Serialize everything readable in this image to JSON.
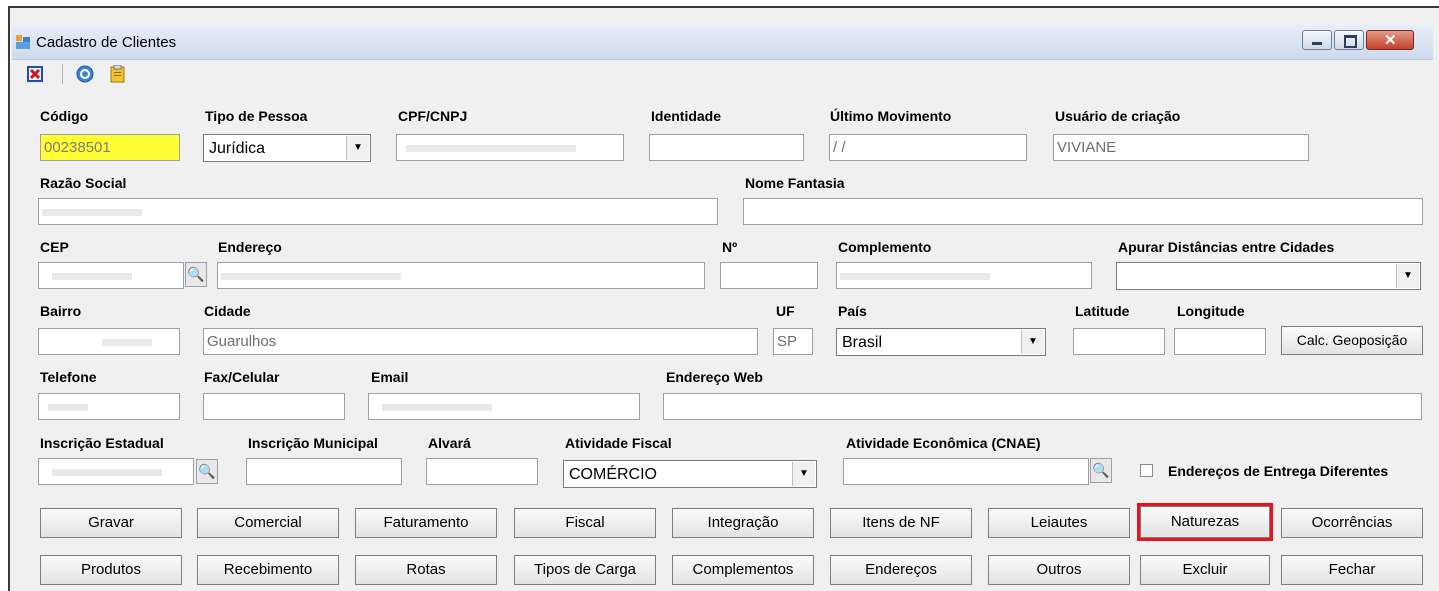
{
  "window": {
    "title": "Cadastro de Clientes"
  },
  "toolbar": {
    "icons": [
      "exit-icon",
      "help-icon",
      "clipboard-icon"
    ]
  },
  "fields": {
    "codigo": {
      "label": "Código",
      "value": "00238501"
    },
    "tipo_pessoa": {
      "label": "Tipo de Pessoa",
      "value": "Jurídica"
    },
    "cpf_cnpj": {
      "label": "CPF/CNPJ",
      "value": ""
    },
    "identidade": {
      "label": "Identidade",
      "value": ""
    },
    "ultimo_movimento": {
      "label": "Último Movimento",
      "value": "/ /"
    },
    "usuario_criacao": {
      "label": "Usuário de criação",
      "value": "VIVIANE"
    },
    "razao_social": {
      "label": "Razão Social",
      "value": ""
    },
    "nome_fantasia": {
      "label": "Nome Fantasia",
      "value": ""
    },
    "cep": {
      "label": "CEP",
      "value": ""
    },
    "endereco": {
      "label": "Endereço",
      "value": ""
    },
    "numero": {
      "label": "Nº",
      "value": ""
    },
    "complemento": {
      "label": "Complemento",
      "value": ""
    },
    "apurar_distancias": {
      "label": "Apurar Distâncias entre Cidades",
      "value": ""
    },
    "bairro": {
      "label": "Bairro",
      "value": ""
    },
    "cidade": {
      "label": "Cidade",
      "value": "Guarulhos"
    },
    "uf": {
      "label": "UF",
      "value": "SP"
    },
    "pais": {
      "label": "País",
      "value": "Brasil"
    },
    "latitude": {
      "label": "Latitude",
      "value": ""
    },
    "longitude": {
      "label": "Longitude",
      "value": ""
    },
    "telefone": {
      "label": "Telefone",
      "value": ""
    },
    "fax_celular": {
      "label": "Fax/Celular",
      "value": ""
    },
    "email": {
      "label": "Email",
      "value": ""
    },
    "endereco_web": {
      "label": "Endereço Web",
      "value": ""
    },
    "inscricao_estadual": {
      "label": "Inscrição Estadual",
      "value": ""
    },
    "inscricao_municipal": {
      "label": "Inscrição Municipal",
      "value": ""
    },
    "alvara": {
      "label": "Alvará",
      "value": ""
    },
    "atividade_fiscal": {
      "label": "Atividade Fiscal",
      "value": "COMÉRCIO"
    },
    "atividade_economica": {
      "label": "Atividade Econômica (CNAE)",
      "value": ""
    },
    "enderecos_entrega": {
      "label": "Endereços de Entrega Diferentes",
      "checked": false
    }
  },
  "buttons": {
    "calc_geoposicao": "Calc. Geoposição",
    "row1": [
      "Gravar",
      "Comercial",
      "Faturamento",
      "Fiscal",
      "Integração",
      "Itens de NF",
      "Leiautes",
      "Naturezas",
      "Ocorrências"
    ],
    "row2": [
      "Produtos",
      "Recebimento",
      "Rotas",
      "Tipos de Carga",
      "Complementos",
      "Endereços",
      "Outros",
      "Excluir",
      "Fechar"
    ]
  },
  "highlight": {
    "button": "Naturezas",
    "color": "#e8141c"
  },
  "colors": {
    "codigo_background": "#ffff33",
    "title_gradient": "#cddaec"
  }
}
